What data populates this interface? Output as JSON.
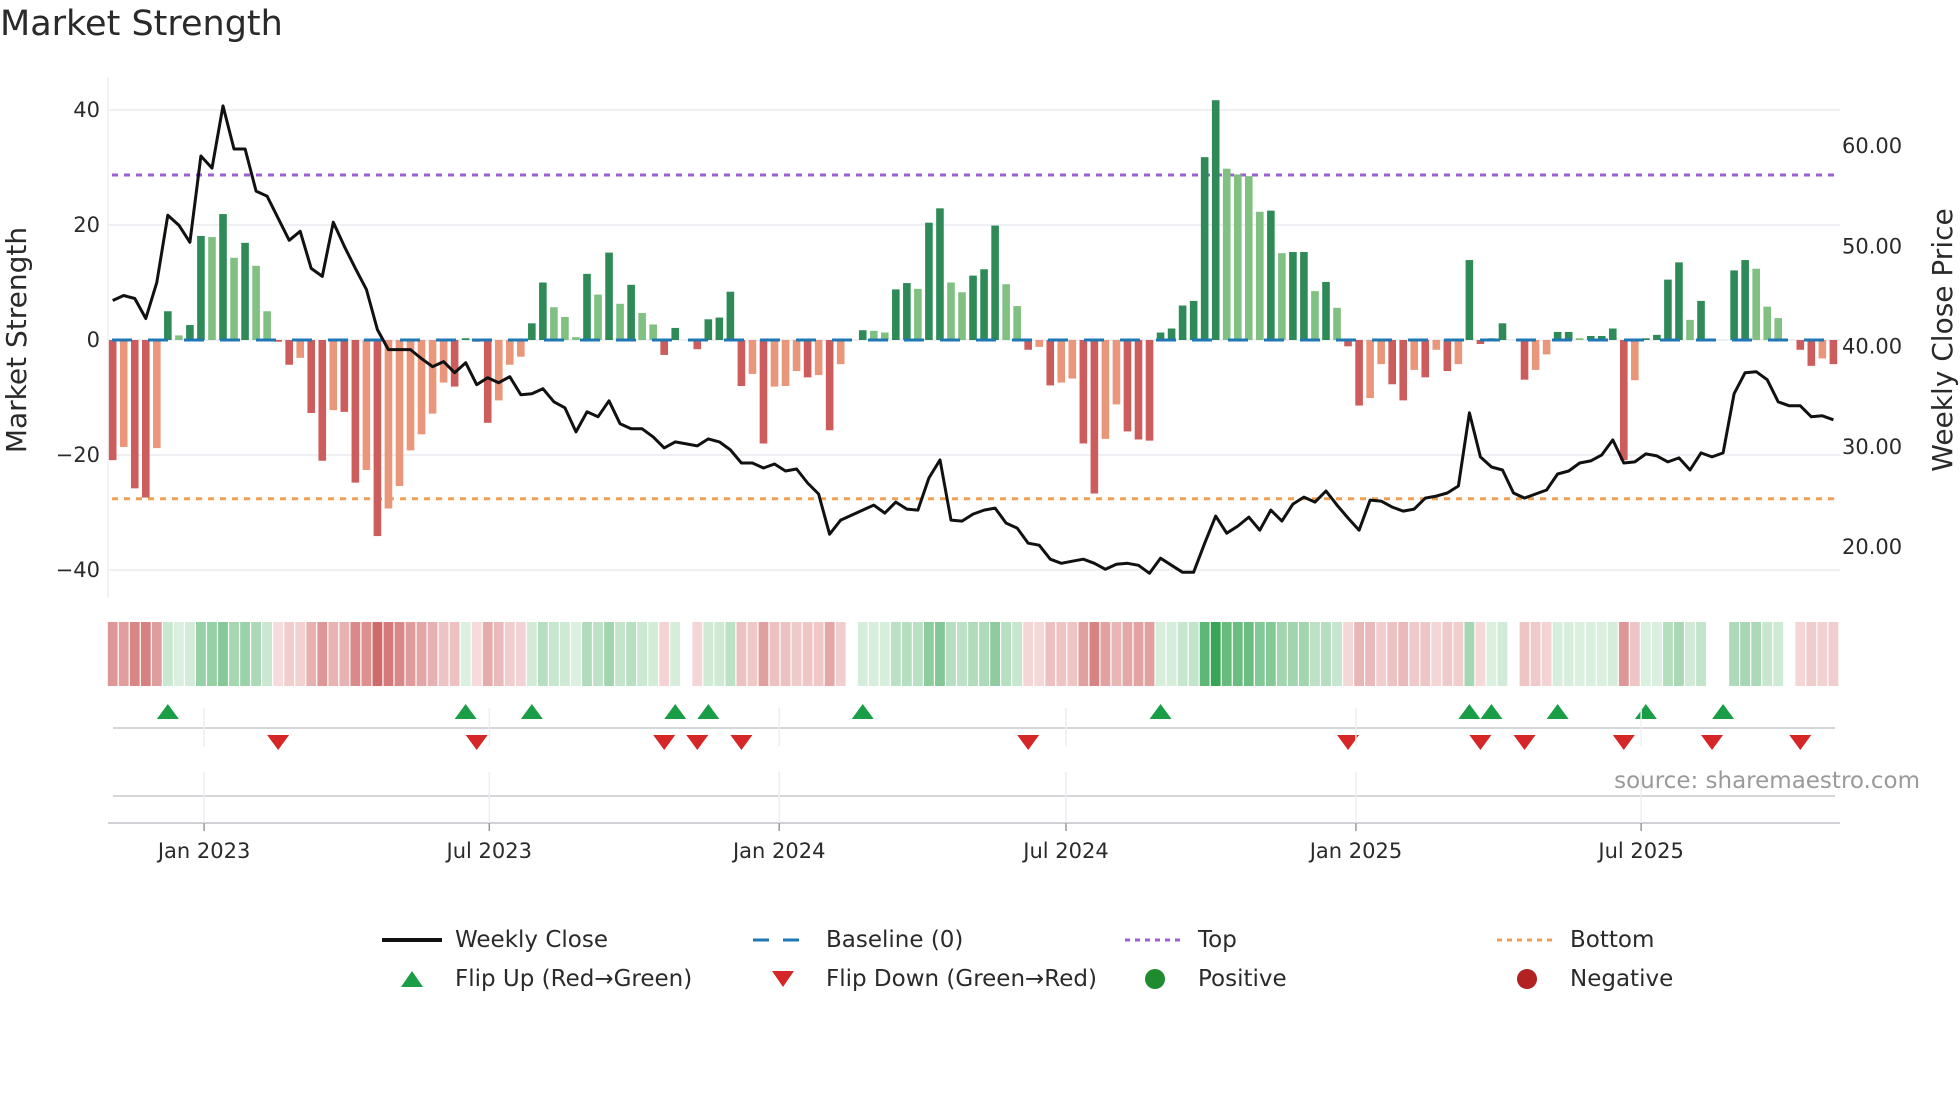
{
  "title": "Market Strength",
  "source": "source: sharemaestro.com",
  "colors": {
    "bar_pos_strong": "#2e8b57",
    "bar_pos_weak": "#80c080",
    "bar_neg_strong": "#cd5c5c",
    "bar_neg_weak": "#e9967a",
    "close_line": "#111111",
    "baseline": "#1f77b4",
    "top": "#9b5fd6",
    "bottom": "#f0a050",
    "flip_up": "#1a9e45",
    "flip_down": "#d62728",
    "positive": "#1e8b2e",
    "negative": "#b22222"
  },
  "legend": [
    {
      "key": "weekly-close",
      "label": "Weekly Close"
    },
    {
      "key": "baseline",
      "label": "Baseline (0)"
    },
    {
      "key": "top",
      "label": "Top"
    },
    {
      "key": "bottom",
      "label": "Bottom"
    },
    {
      "key": "flip-up",
      "label": "Flip Up (Red→Green)"
    },
    {
      "key": "flip-down",
      "label": "Flip Down (Green→Red)"
    },
    {
      "key": "positive",
      "label": "Positive"
    },
    {
      "key": "negative",
      "label": "Negative"
    }
  ],
  "chart_data": {
    "type": "bar",
    "title": "Market Strength",
    "ylabel": "Market Strength",
    "y2label": "Weekly Close Price",
    "x_start": "2022-11-04",
    "x_step_days": 7,
    "ylim": [
      -45,
      45
    ],
    "yticks": [
      40,
      20,
      0,
      -20,
      -40
    ],
    "ytick_labels": [
      "40",
      "20",
      "0",
      "−20",
      "−40"
    ],
    "y2lim": [
      15.4,
      66.5
    ],
    "y2ticks": [
      60,
      50,
      40,
      30,
      20
    ],
    "y2tick_labels": [
      "60.00",
      "50.00",
      "40.00",
      "30.00",
      "20.00"
    ],
    "xticks": [
      {
        "date": "2023-01-01",
        "label": "Jan 2023"
      },
      {
        "date": "2023-07-01",
        "label": "Jul 2023"
      },
      {
        "date": "2024-01-01",
        "label": "Jan 2024"
      },
      {
        "date": "2024-07-01",
        "label": "Jul 2024"
      },
      {
        "date": "2025-01-01",
        "label": "Jan 2025"
      },
      {
        "date": "2025-07-01",
        "label": "Jul 2025"
      }
    ],
    "top_threshold": 28.7,
    "bottom_threshold": -27.6,
    "baseline": 0,
    "grid": true,
    "legend_position": "bottom",
    "strength": [
      -20.9,
      -18.6,
      -25.8,
      -27.4,
      -18.8,
      5.0,
      0.8,
      2.6,
      18.1,
      17.9,
      21.9,
      14.3,
      16.9,
      12.9,
      5.0,
      -0.3,
      -4.3,
      -3.1,
      -12.7,
      -21.0,
      -12.2,
      -12.5,
      -24.8,
      -22.6,
      -34.1,
      -29.3,
      -25.4,
      -19.2,
      -16.4,
      -12.8,
      -7.4,
      -8.1,
      0.3,
      -0.3,
      -14.4,
      -10.5,
      -4.3,
      -2.9,
      2.9,
      10.0,
      5.7,
      4.0,
      0.5,
      11.5,
      7.9,
      15.2,
      6.3,
      9.6,
      4.7,
      2.7,
      -2.6,
      2.1,
      0.2,
      -1.6,
      3.6,
      3.9,
      8.4,
      -8.0,
      -5.9,
      -18.0,
      -8.1,
      -8.0,
      -5.4,
      -6.5,
      -6.1,
      -15.7,
      -4.2,
      -0.2,
      1.7,
      1.6,
      1.3,
      8.8,
      9.9,
      8.9,
      20.4,
      22.9,
      10.0,
      8.3,
      11.2,
      12.3,
      19.9,
      9.7,
      5.9,
      -1.7,
      -1.2,
      -7.9,
      -7.4,
      -6.7,
      -18.0,
      -26.7,
      -17.2,
      -11.2,
      -15.9,
      -17.3,
      -17.5,
      1.3,
      2.0,
      6.0,
      6.8,
      31.8,
      41.7,
      29.8,
      28.8,
      28.5,
      22.3,
      22.5,
      15.1,
      15.3,
      15.3,
      8.5,
      10.1,
      5.6,
      -1.1,
      -11.4,
      -10.1,
      -4.2,
      -7.7,
      -10.5,
      -5.2,
      -6.5,
      -1.7,
      -5.4,
      -4.2,
      13.9,
      -0.7,
      0.3,
      2.9,
      0.2,
      -6.9,
      -5.2,
      -2.5,
      1.4,
      1.4,
      0.3,
      0.7,
      0.7,
      2.0,
      -20.9,
      -7.0,
      0.3,
      0.9,
      10.5,
      13.5,
      3.5,
      6.8,
      -0.2,
      0.2,
      12.1,
      13.9,
      12.4,
      5.8,
      3.8,
      0.2,
      -1.7,
      -4.5,
      -3.2,
      -4.2
    ],
    "weekly_close": [
      44.5,
      45.0,
      44.7,
      42.7,
      46.3,
      53.0,
      52.0,
      50.3,
      58.9,
      57.7,
      63.9,
      59.6,
      59.6,
      55.4,
      54.9,
      52.7,
      50.5,
      51.4,
      47.7,
      46.9,
      52.3,
      49.9,
      47.7,
      45.6,
      41.6,
      39.6,
      39.6,
      39.6,
      38.7,
      37.9,
      38.4,
      37.3,
      38.3,
      36.1,
      36.8,
      36.3,
      36.9,
      35.1,
      35.2,
      35.7,
      34.4,
      33.8,
      31.4,
      33.4,
      32.9,
      34.5,
      32.2,
      31.7,
      31.7,
      30.9,
      29.8,
      30.4,
      30.2,
      30.0,
      30.7,
      30.4,
      29.6,
      28.3,
      28.3,
      27.8,
      28.2,
      27.5,
      27.7,
      26.3,
      25.2,
      21.2,
      22.6,
      23.1,
      23.6,
      24.1,
      23.3,
      24.4,
      23.7,
      23.6,
      26.8,
      28.6,
      22.6,
      22.5,
      23.2,
      23.6,
      23.8,
      22.3,
      21.8,
      20.3,
      20.1,
      18.7,
      18.3,
      18.5,
      18.7,
      18.3,
      17.7,
      18.2,
      18.3,
      18.1,
      17.3,
      18.8,
      18.1,
      17.4,
      17.4,
      20.3,
      23.0,
      21.3,
      22.0,
      22.9,
      21.6,
      23.6,
      22.5,
      24.2,
      24.9,
      24.4,
      25.5,
      24.1,
      22.8,
      21.6,
      24.6,
      24.5,
      23.9,
      23.5,
      23.7,
      24.8,
      25.0,
      25.3,
      26.0,
      33.3,
      28.9,
      27.9,
      27.6,
      25.3,
      24.8,
      25.2,
      25.6,
      27.2,
      27.5,
      28.3,
      28.5,
      29.1,
      30.6,
      28.3,
      28.4,
      29.2,
      29.0,
      28.4,
      28.8,
      27.6,
      29.3,
      28.9,
      29.3,
      35.2,
      37.3,
      37.4,
      36.6,
      34.4,
      34.0,
      34.0,
      32.9,
      33.0,
      32.6
    ]
  }
}
